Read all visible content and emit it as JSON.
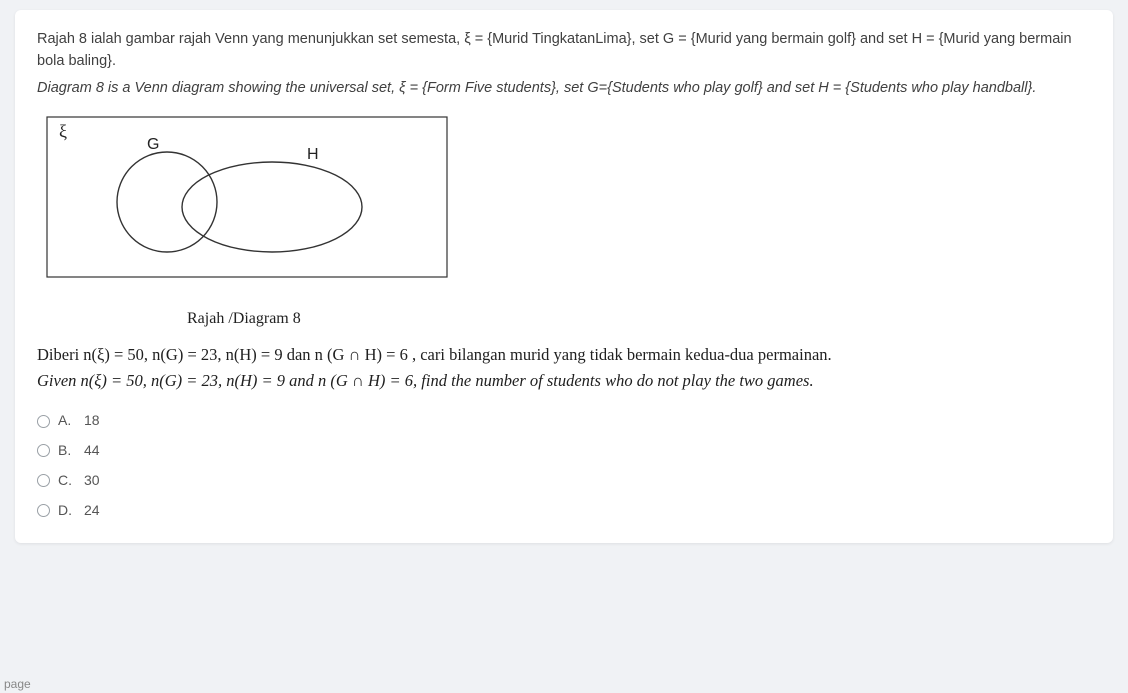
{
  "question": {
    "intro_my": "Rajah 8 ialah gambar rajah Venn yang menunjukkan set semesta, ξ = {Murid TingkatanLima}, set G = {Murid yang bermain golf} and set H = {Murid yang bermain bola baling}.",
    "intro_en": "Diagram 8 is a Venn diagram showing the universal set, ξ = {Form Five students}, set G={Students who play golf} and set H = {Students who play handball}.",
    "venn": {
      "universal_label": "ξ",
      "set_g_label": "G",
      "set_h_label": "H"
    },
    "caption": "Rajah /Diagram 8",
    "given_my": "Diberi n(ξ) = 50, n(G) = 23, n(H) = 9 dan n (G ∩ H) = 6 , cari bilangan murid yang tidak bermain kedua-dua permainan.",
    "given_en": "Given n(ξ) = 50, n(G) = 23, n(H) = 9 and n (G ∩ H) = 6, find the number of students who do not play the two games.",
    "options": [
      {
        "letter": "A.",
        "value": "18"
      },
      {
        "letter": "B.",
        "value": "44"
      },
      {
        "letter": "C.",
        "value": "30"
      },
      {
        "letter": "D.",
        "value": "24"
      }
    ]
  },
  "footer": {
    "page_hint": "page"
  }
}
